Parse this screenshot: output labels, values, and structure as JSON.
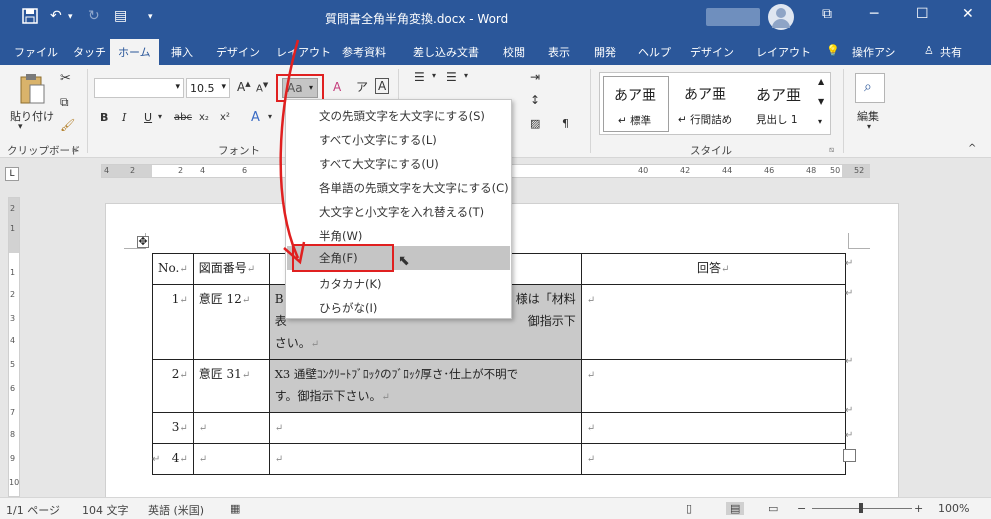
{
  "titlebar": {
    "title": "質問書全角半角変換.docx  -  Word",
    "save_icon": "save-icon",
    "undo_icon": "undo-icon",
    "redo_icon": "redo-icon",
    "minimize": "─",
    "maximize": "☐",
    "close": "✕",
    "ribbon_display": "⧉"
  },
  "tabs": [
    "ファイル",
    "タッチ",
    "ホーム",
    "挿入",
    "デザイン",
    "レイアウト",
    "参考資料",
    "差し込み文書",
    "校閲",
    "表示",
    "開発",
    "ヘルプ",
    "デザイン",
    "レイアウト"
  ],
  "tell_me": "操作アシ",
  "share": "共有",
  "ribbon": {
    "paste_label": "貼り付け",
    "clipboard_label": "クリップボード",
    "font_group_label": "フォント",
    "font_name": "",
    "font_size": "10.5",
    "change_case": "Aa",
    "bold": "B",
    "italic": "I",
    "underline": "U",
    "strike": "abc",
    "subscript": "x₂",
    "superscript": "x²",
    "style_group_label": "スタイル",
    "styles": [
      {
        "preview": "あア亜",
        "name": "↵ 標準"
      },
      {
        "preview": "あア亜",
        "name": "↵ 行間詰め"
      },
      {
        "preview": "あア亜",
        "name": "見出し 1"
      }
    ],
    "edit_label": "編集"
  },
  "ruler": {
    "h_numbers": [
      "4",
      "2",
      "2",
      "4",
      "6",
      "40",
      "42",
      "44",
      "46",
      "48",
      "50",
      "52"
    ],
    "v_numbers": [
      "2",
      "1",
      "1",
      "2",
      "3",
      "4",
      "5",
      "6",
      "7",
      "8",
      "9",
      "10"
    ]
  },
  "menu": {
    "items": [
      "文の先頭文字を大文字にする(S)",
      "すべて小文字にする(L)",
      "すべて大文字にする(U)",
      "各単語の先頭文字を大文字にする(C)",
      "大文字と小文字を入れ替える(T)",
      "半角(W)",
      "全角(F)",
      "カタカナ(K)",
      "ひらがな(I)"
    ],
    "selected_index": 6
  },
  "table": {
    "headers": [
      "No.",
      "図面番号",
      "",
      "回答"
    ],
    "rows": [
      {
        "no": "1",
        "ref": "意匠 12",
        "q": "B ... 様は「材料 表 ... 御指示下さい。",
        "q_lines": [
          "B",
          "様は「材料",
          "表",
          "御指示下",
          "さい。"
        ],
        "a": ""
      },
      {
        "no": "2",
        "ref": "意匠 31",
        "q_lines": [
          "X3 通壁ｺﾝｸﾘｰﾄﾌﾞﾛｯｸのﾌﾞﾛｯｸ厚さ･仕上が不明で",
          "す。御指示下さい。"
        ],
        "a": ""
      },
      {
        "no": "3",
        "ref": "",
        "q_lines": [
          ""
        ],
        "a": ""
      },
      {
        "no": "4",
        "ref": "",
        "q_lines": [
          ""
        ],
        "a": ""
      }
    ]
  },
  "status": {
    "page": "1/1 ページ",
    "words": "104 文字",
    "language": "英語 (米国)",
    "zoom": "100%",
    "minus": "−",
    "plus": "+"
  },
  "colors": {
    "accent": "#2b579a",
    "highlight_red": "#e02020"
  }
}
